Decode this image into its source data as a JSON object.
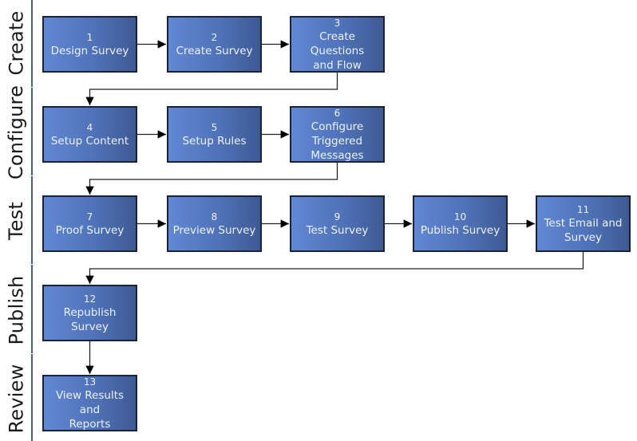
{
  "diagram": {
    "type": "swimlane-flowchart",
    "colors": {
      "box_fill_light": "#6188d4",
      "box_fill_dark": "#3e5a94",
      "box_border": "#1b2233",
      "box_text": "#eef2fb",
      "lane_line": "#4b5f86",
      "connector": "#000000"
    },
    "lanes": [
      {
        "id": "create",
        "label": "Create"
      },
      {
        "id": "configure",
        "label": "Configure"
      },
      {
        "id": "test",
        "label": "Test"
      },
      {
        "id": "publish",
        "label": "Publish"
      },
      {
        "id": "review",
        "label": "Review"
      }
    ],
    "steps": [
      {
        "num": "1",
        "label": "Design Survey",
        "lane": "create"
      },
      {
        "num": "2",
        "label": "Create Survey",
        "lane": "create"
      },
      {
        "num": "3",
        "label": "Create Questions\nand Flow",
        "lane": "create"
      },
      {
        "num": "4",
        "label": "Setup Content",
        "lane": "configure"
      },
      {
        "num": "5",
        "label": "Setup Rules",
        "lane": "configure"
      },
      {
        "num": "6",
        "label": "Configure\nTriggered\nMessages",
        "lane": "configure"
      },
      {
        "num": "7",
        "label": "Proof Survey",
        "lane": "test"
      },
      {
        "num": "8",
        "label": "Preview Survey",
        "lane": "test"
      },
      {
        "num": "9",
        "label": "Test Survey",
        "lane": "test"
      },
      {
        "num": "10",
        "label": "Publish Survey",
        "lane": "test"
      },
      {
        "num": "11",
        "label": "Test Email and\nSurvey",
        "lane": "test"
      },
      {
        "num": "12",
        "label": "Republish Survey",
        "lane": "publish"
      },
      {
        "num": "13",
        "label": "View Results and\nReports",
        "lane": "review"
      }
    ],
    "edges": [
      {
        "from": "1",
        "to": "2"
      },
      {
        "from": "2",
        "to": "3"
      },
      {
        "from": "3",
        "to": "4"
      },
      {
        "from": "4",
        "to": "5"
      },
      {
        "from": "5",
        "to": "6"
      },
      {
        "from": "6",
        "to": "7"
      },
      {
        "from": "7",
        "to": "8"
      },
      {
        "from": "8",
        "to": "9"
      },
      {
        "from": "9",
        "to": "10"
      },
      {
        "from": "10",
        "to": "11"
      },
      {
        "from": "11",
        "to": "12"
      },
      {
        "from": "12",
        "to": "13"
      }
    ]
  }
}
